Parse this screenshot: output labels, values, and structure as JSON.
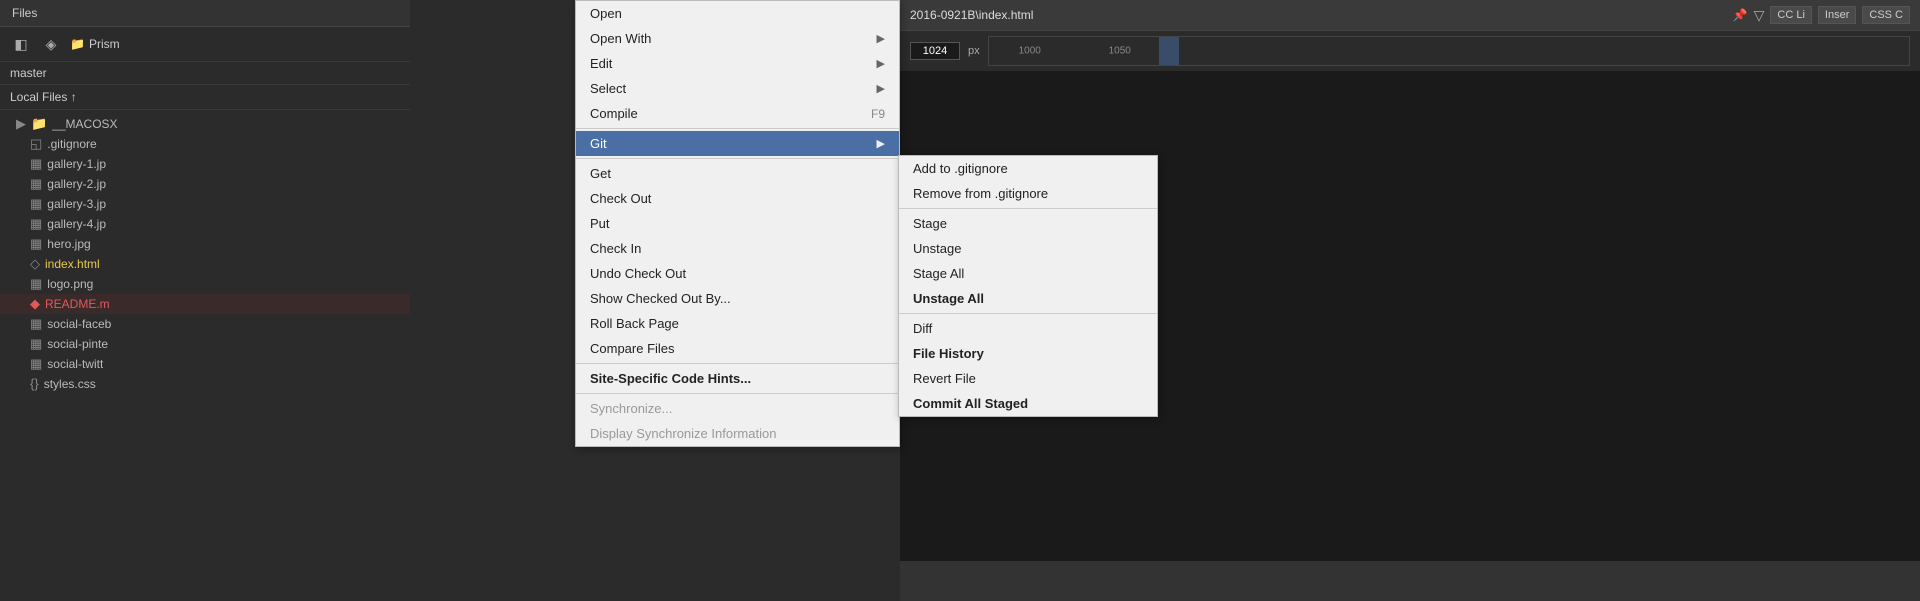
{
  "files_panel": {
    "header": "Files",
    "toolbar": {
      "icon1": "◧",
      "icon2": "◈",
      "prism_label": "Prism"
    },
    "branch": "master",
    "local_files_label": "Local Files ↑",
    "tree": [
      {
        "type": "folder",
        "name": "__MACOSX",
        "indent": 1,
        "icon": "▶",
        "folder": true
      },
      {
        "type": "file",
        "name": ".gitignore",
        "indent": 2,
        "icon": "◱"
      },
      {
        "type": "file",
        "name": "gallery-1.jp",
        "indent": 2,
        "icon": "▦",
        "img": true
      },
      {
        "type": "file",
        "name": "gallery-2.jp",
        "indent": 2,
        "icon": "▦",
        "img": true
      },
      {
        "type": "file",
        "name": "gallery-3.jp",
        "indent": 2,
        "icon": "▦",
        "img": true
      },
      {
        "type": "file",
        "name": "gallery-4.jp",
        "indent": 2,
        "icon": "▦",
        "img": true
      },
      {
        "type": "file",
        "name": "hero.jpg",
        "indent": 2,
        "icon": "▦",
        "img": true
      },
      {
        "type": "file",
        "name": "index.html",
        "indent": 2,
        "icon": "◇",
        "yellow": true
      },
      {
        "type": "file",
        "name": "logo.png",
        "indent": 2,
        "icon": "▦",
        "img": true
      },
      {
        "type": "file",
        "name": "README.m",
        "indent": 2,
        "icon": "◆",
        "red": true
      },
      {
        "type": "file",
        "name": "social-faceb",
        "indent": 2,
        "icon": "▦",
        "img": true
      },
      {
        "type": "file",
        "name": "social-pinte",
        "indent": 2,
        "icon": "▦",
        "img": true
      },
      {
        "type": "file",
        "name": "social-twitt",
        "indent": 2,
        "icon": "▦",
        "img": true
      },
      {
        "type": "file",
        "name": "styles.css",
        "indent": 2,
        "icon": "{}"
      }
    ]
  },
  "context_menu_main": {
    "items": [
      {
        "label": "Open",
        "type": "item"
      },
      {
        "label": "Open With",
        "type": "submenu"
      },
      {
        "label": "Edit",
        "type": "submenu"
      },
      {
        "label": "Select",
        "type": "submenu"
      },
      {
        "label": "Compile",
        "shortcut": "F9",
        "type": "item"
      },
      {
        "label": "Git",
        "type": "submenu",
        "highlighted": true
      },
      {
        "label": "Get",
        "type": "item"
      },
      {
        "label": "Check Out",
        "type": "item"
      },
      {
        "label": "Put",
        "type": "item"
      },
      {
        "label": "Check In",
        "type": "item"
      },
      {
        "label": "Undo Check Out",
        "type": "item"
      },
      {
        "label": "Show Checked Out By...",
        "type": "item"
      },
      {
        "label": "Roll Back Page",
        "type": "item"
      },
      {
        "label": "Compare Files",
        "type": "item"
      },
      {
        "label": "Site-Specific Code Hints...",
        "type": "item",
        "bold": true
      },
      {
        "label": "Synchronize...",
        "type": "item",
        "disabled": true
      },
      {
        "label": "Display Synchronize Information",
        "type": "item",
        "disabled": true
      }
    ]
  },
  "context_menu_git": {
    "items": [
      {
        "label": "Add to .gitignore",
        "type": "item"
      },
      {
        "label": "Remove from .gitignore",
        "type": "item"
      },
      {
        "label": "Stage",
        "type": "item"
      },
      {
        "label": "Unstage",
        "type": "item"
      },
      {
        "label": "Stage All",
        "type": "item"
      },
      {
        "label": "Unstage All",
        "type": "item",
        "bold": true
      },
      {
        "label": "Diff",
        "type": "item"
      },
      {
        "label": "File History",
        "type": "item",
        "bold": true
      },
      {
        "label": "Revert File",
        "type": "item"
      },
      {
        "label": "Commit All Staged",
        "type": "item",
        "bold": true
      }
    ]
  },
  "right_panel": {
    "file_title": "2016-0921B\\index.html",
    "px_value": "1024",
    "px_label": "px",
    "ruler_values": [
      "1000",
      "1050"
    ],
    "cc_label": "CC Li",
    "insert_label": "Inser",
    "css_label": "CSS C"
  }
}
